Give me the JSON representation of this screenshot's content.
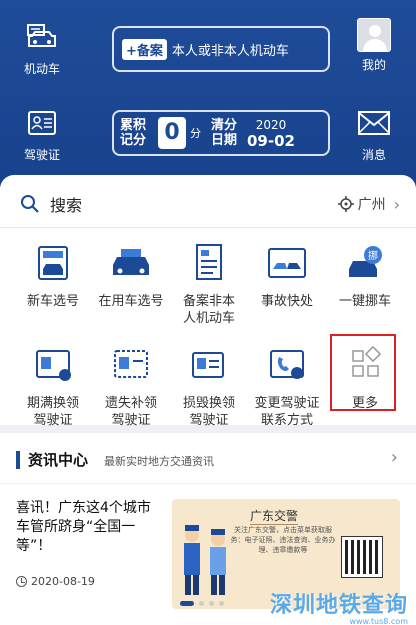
{
  "header": {
    "vehicle_label": "机动车",
    "license_label": "驾驶证",
    "me_label": "我的",
    "message_label": "消息",
    "record": {
      "tag": "+备案",
      "text": "本人或非本人机动车"
    },
    "score": {
      "label_top": "累积",
      "label_bottom": "记分",
      "value": "0",
      "unit": "分",
      "clear_top": "清分",
      "clear_bottom": "日期",
      "year": "2020",
      "month_day": "09-02"
    }
  },
  "search": {
    "label": "搜索",
    "city": "广州"
  },
  "services": [
    {
      "line1": "新车选号",
      "line2": ""
    },
    {
      "line1": "在用车选号",
      "line2": ""
    },
    {
      "line1": "备案非本",
      "line2": "人机动车"
    },
    {
      "line1": "事故快处",
      "line2": ""
    },
    {
      "line1": "一键挪车",
      "line2": ""
    },
    {
      "line1": "期满换领",
      "line2": "驾驶证"
    },
    {
      "line1": "遗失补领",
      "line2": "驾驶证"
    },
    {
      "line1": "损毁换领",
      "line2": "驾驶证"
    },
    {
      "line1": "变更驾驶证",
      "line2": "联系方式"
    },
    {
      "line1": "更多",
      "line2": ""
    }
  ],
  "news": {
    "title": "资讯中心",
    "subtitle": "最新实时地方交通资讯",
    "article": {
      "title": "喜讯！广东这4个城市车管所跻身“全国一等”！",
      "date": "2020-08-19"
    },
    "banner": {
      "title": "广东交警",
      "text": "关注广东交警，点击菜单获取服务：电子证照、违法查询、业务办理、违章缴款等"
    }
  },
  "watermark": {
    "text": "深圳地铁查询",
    "url": "www.tus8.com"
  },
  "colors": {
    "primary": "#1d4a96",
    "header_bg": "#1f4c9a",
    "highlight": "#e02020"
  }
}
